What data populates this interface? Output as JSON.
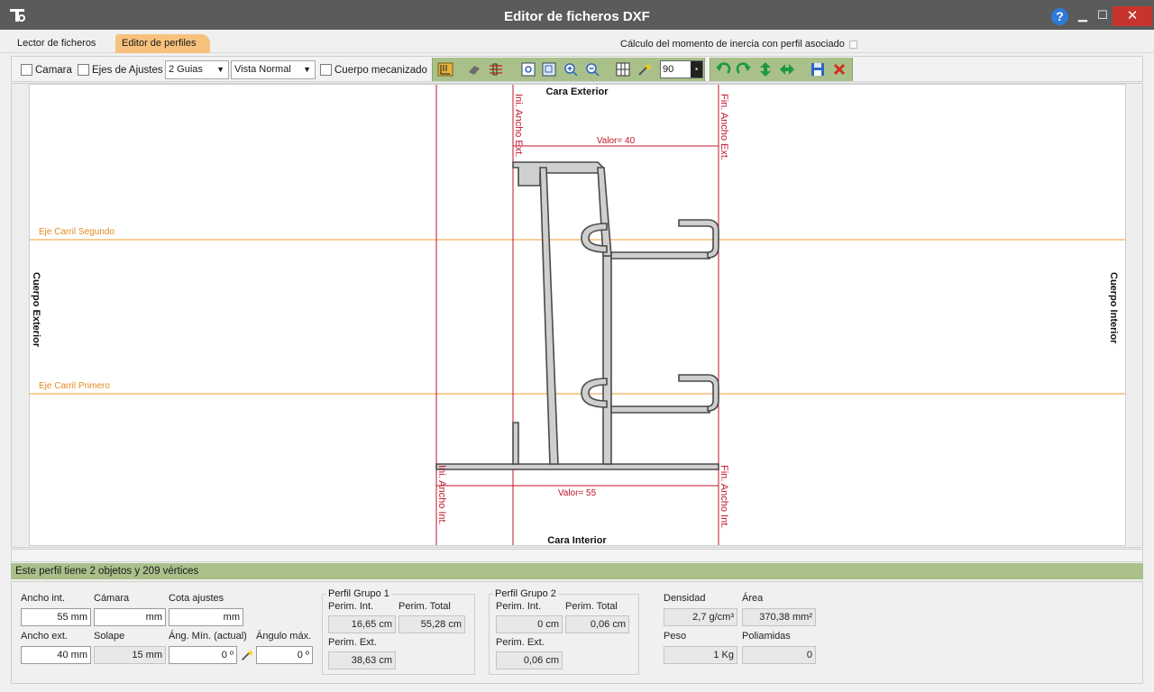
{
  "window": {
    "title": "Editor de ficheros DXF",
    "help": "?",
    "minimize": "▁",
    "maximize": "☐",
    "close": "✕"
  },
  "tabs": [
    {
      "label": "Lector de ficheros"
    },
    {
      "label": "Editor de perfiles"
    }
  ],
  "inercia_label": "Cálculo del momento de inercia con perfil asociado",
  "toolbar": {
    "camara": "Camara",
    "ejes": "Ejes de Ajustes",
    "guias": "2 Guias",
    "vista": "Vista Normal",
    "cuerpo": "Cuerpo mecanizado",
    "angle": "90"
  },
  "drawing": {
    "cara_exterior": "Cara Exterior",
    "cara_interior": "Cara Interior",
    "cuerpo_exterior": "Cuerpo Exterior",
    "cuerpo_interior": "Cuerpo Interior",
    "eje_segundo": "Eje Carril Segundo",
    "eje_primero": "Eje Carril Primero",
    "ini_ancho_ext": "Ini. Ancho Ext.",
    "fin_ancho_ext": "Fin. Ancho Ext.",
    "ini_ancho_int": "Ini. Ancho Int.",
    "fin_ancho_int": "Fin. Ancho Int.",
    "valor_top": "Valor= 40",
    "valor_bottom": "Valor= 55",
    "accent_red": "#c0142a",
    "accent_orange": "#f39a2c"
  },
  "status": "Este perfil tiene 2 objetos y 209 vértices",
  "form": {
    "ancho_int": {
      "label": "Ancho int.",
      "value": "55 mm"
    },
    "camara": {
      "label": "Cámara",
      "value": "mm"
    },
    "cota": {
      "label": "Cota ajustes",
      "value": "mm"
    },
    "ancho_ext": {
      "label": "Ancho ext.",
      "value": "40 mm"
    },
    "solape": {
      "label": "Solape",
      "value": "15 mm"
    },
    "ang_min": {
      "label": "Áng. Mín. (actual)",
      "value": "0 º"
    },
    "ang_max": {
      "label": "Ángulo máx.",
      "value": "0 º"
    }
  },
  "grupo1": {
    "title": "Perfil Grupo 1",
    "perim_int_label": "Perim. Int.",
    "perim_int": "16,65 cm",
    "perim_total_label": "Perim. Total",
    "perim_total": "55,28 cm",
    "perim_ext_label": "Perim. Ext.",
    "perim_ext": "38,63 cm"
  },
  "grupo2": {
    "title": "Perfil Grupo 2",
    "perim_int_label": "Perim. Int.",
    "perim_int": "0 cm",
    "perim_total_label": "Perim. Total",
    "perim_total": "0,06 cm",
    "perim_ext_label": "Perim. Ext.",
    "perim_ext": "0,06 cm"
  },
  "props": {
    "densidad_label": "Densidad",
    "densidad": "2,7 g/cm³",
    "area_label": "Área",
    "area": "370,38 mm²",
    "peso_label": "Peso",
    "peso": "1 Kg",
    "poliamidas_label": "Poliamidas",
    "poliamidas": "0"
  }
}
